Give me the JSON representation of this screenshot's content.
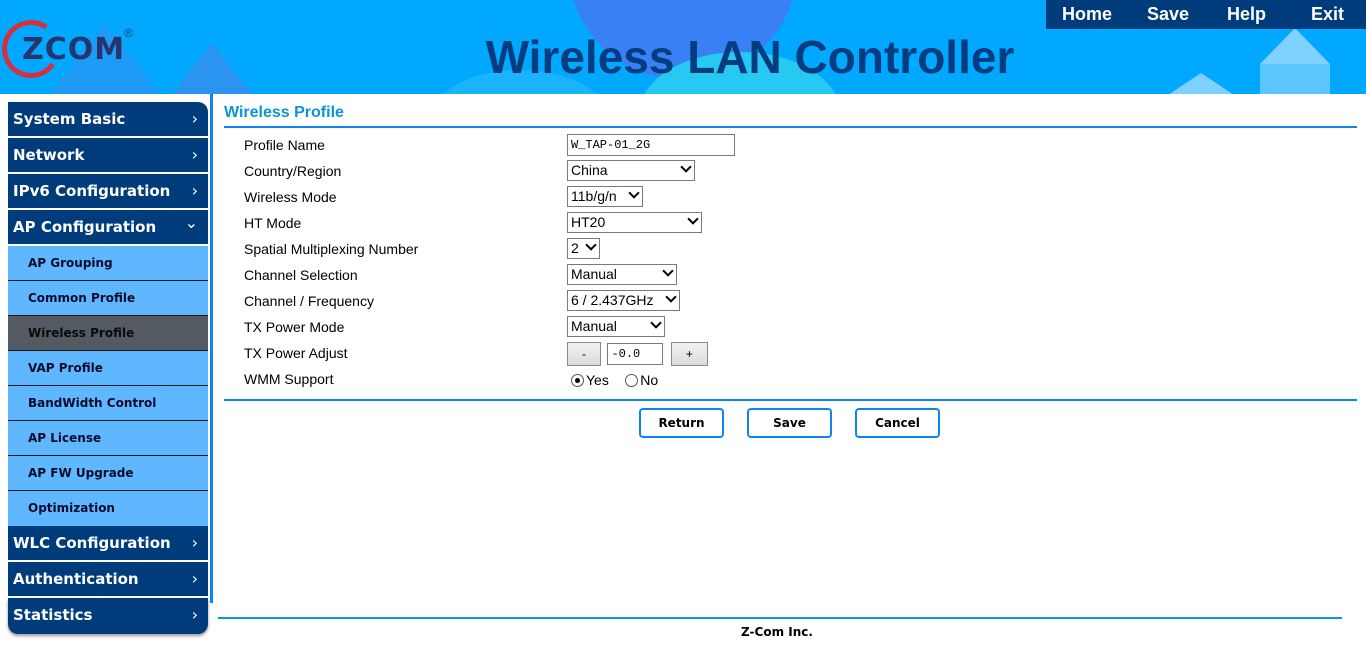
{
  "header": {
    "logo_text": "ZCOM",
    "logo_reg": "®",
    "app_title": "Wireless LAN Controller",
    "nav": {
      "home": "Home",
      "save": "Save",
      "help": "Help",
      "exit": "Exit"
    }
  },
  "sidebar": {
    "sections": [
      {
        "label": "System Basic",
        "icon": "chevron-right-icon",
        "glyph": "›"
      },
      {
        "label": "Network",
        "icon": "chevron-right-icon",
        "glyph": "›"
      },
      {
        "label": "IPv6 Configuration",
        "icon": "chevron-right-icon",
        "glyph": "›"
      },
      {
        "label": "AP Configuration",
        "icon": "chevron-down-icon",
        "glyph": "⌄",
        "expanded": true
      },
      {
        "label": "WLC Configuration",
        "icon": "chevron-right-icon",
        "glyph": "›"
      },
      {
        "label": "Authentication",
        "icon": "chevron-right-icon",
        "glyph": "›"
      },
      {
        "label": "Statistics",
        "icon": "chevron-right-icon",
        "glyph": "›"
      }
    ],
    "ap_items": [
      {
        "label": "AP Grouping"
      },
      {
        "label": "Common Profile"
      },
      {
        "label": "Wireless Profile",
        "active": true
      },
      {
        "label": "VAP Profile"
      },
      {
        "label": "BandWidth Control"
      },
      {
        "label": "AP License"
      },
      {
        "label": "AP FW Upgrade"
      },
      {
        "label": "Optimization"
      }
    ]
  },
  "main": {
    "title": "Wireless Profile",
    "fields": {
      "profile_name": {
        "label": "Profile Name",
        "value": "W_TAP-01_2G"
      },
      "country": {
        "label": "Country/Region",
        "value": "China"
      },
      "wireless_mode": {
        "label": "Wireless Mode",
        "value": "11b/g/n"
      },
      "ht_mode": {
        "label": "HT Mode",
        "value": "HT20"
      },
      "spatial": {
        "label": "Spatial Multiplexing Number",
        "value": "2"
      },
      "channel_selection": {
        "label": "Channel Selection",
        "value": "Manual"
      },
      "channel_freq": {
        "label": "Channel / Frequency",
        "value": "6 / 2.437GHz"
      },
      "tx_power_mode": {
        "label": "TX Power Mode",
        "value": "Manual"
      },
      "tx_power_adjust": {
        "label": "TX Power Adjust",
        "value": "-0.0",
        "minus": "-",
        "plus": "+"
      },
      "wmm": {
        "label": "WMM Support",
        "options": [
          "Yes",
          "No"
        ],
        "selected": "Yes"
      }
    },
    "buttons": {
      "return": "Return",
      "save": "Save",
      "cancel": "Cancel"
    }
  },
  "footer": {
    "text": "Z-Com Inc."
  }
}
